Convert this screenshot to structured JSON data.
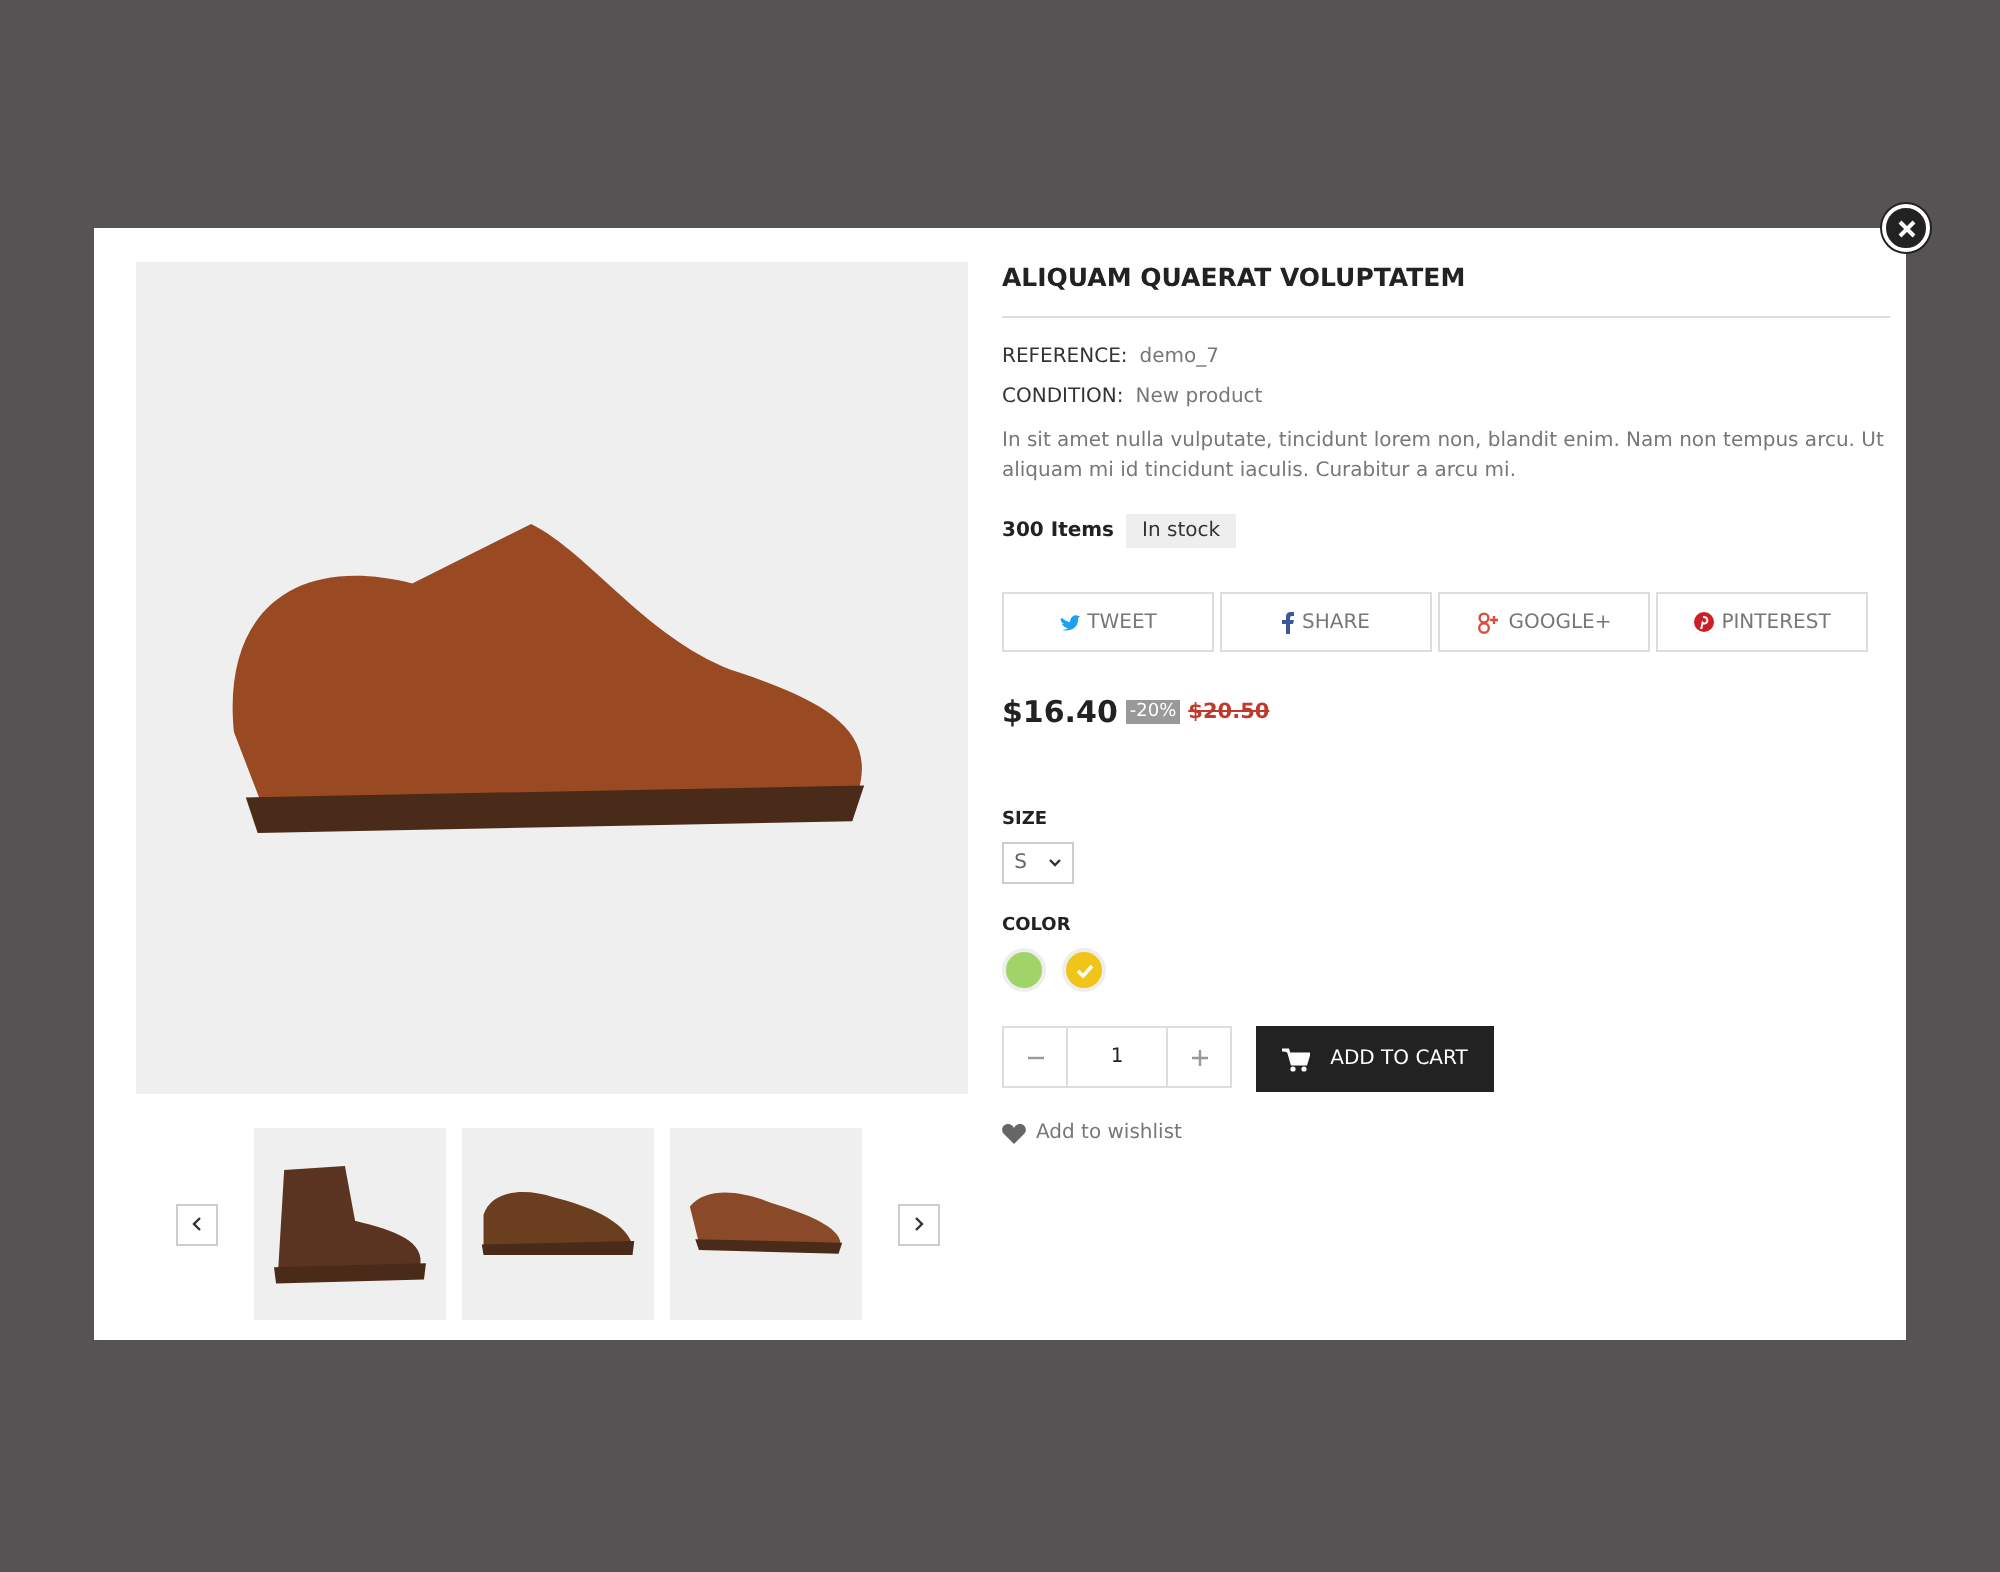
{
  "product": {
    "title": "ALIQUAM QUAERAT VOLUPTATEM",
    "details": [
      {
        "label": "REFERENCE:",
        "value": "demo_7"
      },
      {
        "label": "CONDITION:",
        "value": "New product"
      }
    ],
    "description": "In sit amet nulla vulputate, tincidunt lorem non, blandit enim. Nam non tempus arcu. Ut aliquam mi id tincidunt iaculis. Curabitur a arcu mi.",
    "quantity_available": "300 Items",
    "availability": "In stock",
    "share_buttons": [
      {
        "kind": "twitter",
        "label": "TWEET"
      },
      {
        "kind": "facebook",
        "label": "SHARE"
      },
      {
        "kind": "googleplus",
        "label": "GOOGLE+"
      },
      {
        "kind": "pinterest",
        "label": "PINTEREST"
      }
    ],
    "price": "$16.40",
    "discount": "-20%",
    "old_price": "$20.50",
    "size": {
      "label": "SIZE",
      "value": "S"
    },
    "color": {
      "label": "COLOR",
      "options": [
        {
          "color": "#a0d468",
          "selected": false
        },
        {
          "color": "#f0c419",
          "selected": true
        }
      ]
    },
    "quantity": "1",
    "add_to_cart": "ADD TO CART",
    "wishlist": "Add to wishlist"
  },
  "thumbnails": [
    {
      "kind": "boot"
    },
    {
      "kind": "monk"
    },
    {
      "kind": "wingtip"
    }
  ]
}
